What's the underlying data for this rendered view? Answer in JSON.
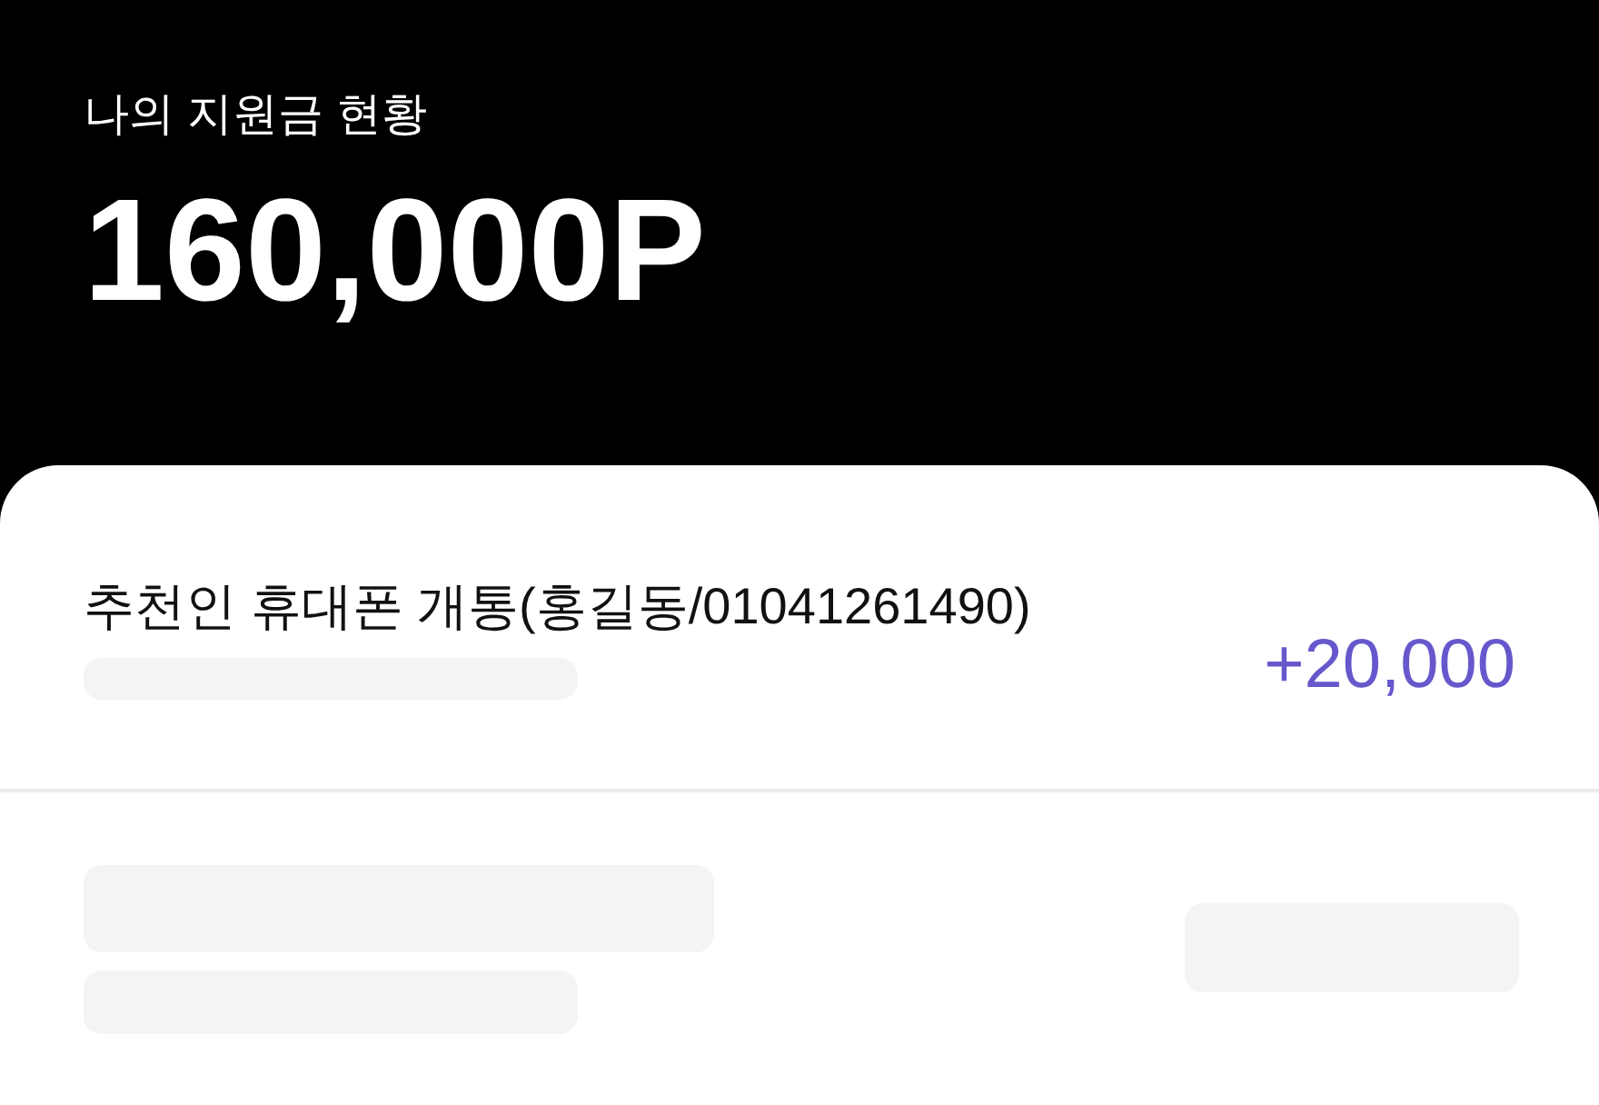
{
  "header": {
    "label": "나의 지원금 현황",
    "total": "160,000P"
  },
  "entries": [
    {
      "kind": "record",
      "title": "추천인 휴대폰 개통(홍길동/01041261490)",
      "amount": "+20,000"
    },
    {
      "kind": "loading"
    }
  ]
}
